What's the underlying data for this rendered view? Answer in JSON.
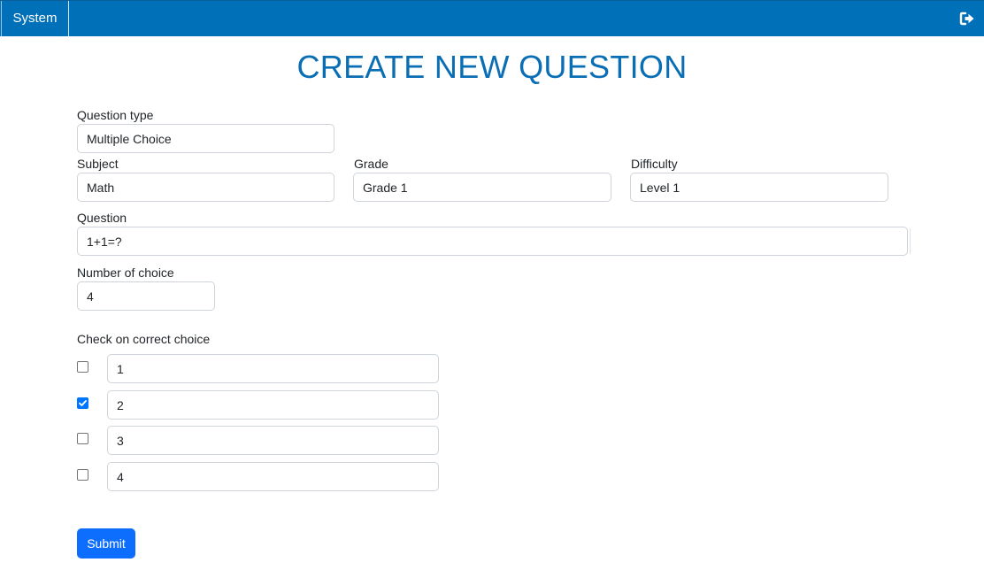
{
  "navbar": {
    "brand": "System",
    "logout_icon": "sign-out-icon"
  },
  "page": {
    "title": "CREATE NEW QUESTION"
  },
  "form": {
    "question_type": {
      "label": "Question type",
      "value": "Multiple Choice"
    },
    "subject": {
      "label": "Subject",
      "value": "Math"
    },
    "grade": {
      "label": "Grade",
      "value": "Grade 1"
    },
    "difficulty": {
      "label": "Difficulty",
      "value": "Level 1"
    },
    "question": {
      "label": "Question",
      "value": "1+1=?"
    },
    "num_choices": {
      "label": "Number of choice",
      "value": "4"
    },
    "choices_label": "Check on correct choice",
    "choices": [
      {
        "value": "1",
        "correct": false
      },
      {
        "value": "2",
        "correct": true
      },
      {
        "value": "3",
        "correct": false
      },
      {
        "value": "4",
        "correct": false
      }
    ],
    "submit_label": "Submit"
  },
  "colors": {
    "navbar": "#0070b8",
    "title": "#0a6eb5",
    "submit": "#0d6efd",
    "checkbox_checked": "#0075ff"
  }
}
